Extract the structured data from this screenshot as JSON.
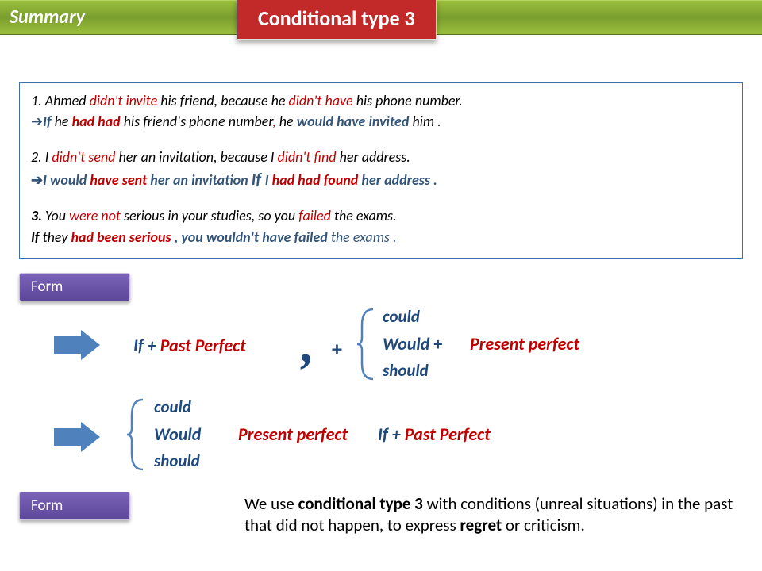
{
  "header": {
    "summary": "Summary",
    "title": "Conditional type 3"
  },
  "examples": {
    "e1a_pre": "1. Ahmed ",
    "e1a_red1": "didn't invite ",
    "e1a_mid": "his friend, because he ",
    "e1a_red2": "didn't have ",
    "e1a_post": "his phone number.",
    "e1b_if": "If ",
    "e1b_1": "he ",
    "e1b_red1": "had had ",
    "e1b_2": "his friend's phone number",
    "e1b_commaRed": ", ",
    "e1b_3": "he ",
    "e1b_steel": "would have invited ",
    "e1b_4": "him .",
    "e2a_pre": "2. I ",
    "e2a_red1": "didn't send ",
    "e2a_mid": "her an invitation, because I ",
    "e2a_red2": "didn't find ",
    "e2a_post": "her address.",
    "e2b_1": "I would ",
    "e2b_red1": "have sent ",
    "e2b_2": "her an invitation ",
    "e2b_if": "If ",
    "e2b_3": "I ",
    "e2b_red2": "had had found ",
    "e2b_4": "her address .",
    "e3a_pre": "3. ",
    "e3a_1": "You ",
    "e3a_red1": "were not ",
    "e3a_2": "serious in your studies, so you ",
    "e3a_red2": "failed ",
    "e3a_3": "the exams.",
    "e3b_if": "If  ",
    "e3b_1": "they ",
    "e3b_red1": "had  been serious ",
    "e3b_2": ", you ",
    "e3b_u": "wouldn't",
    "e3b_3": " have failed ",
    "e3b_4": "the exams ."
  },
  "form": {
    "label": "Form",
    "ifPlus": "If + ",
    "pastPerfect": "Past Perfect",
    "comma": ",",
    "plus": "+",
    "could": "could",
    "would": "Would",
    "wouldPlus": "Would +",
    "should": "should",
    "presentPerfect": "Present perfect"
  },
  "usage": {
    "t1": "We use ",
    "bold1": "conditional type 3 ",
    "t2": "with conditions (unreal situations)  in the past that did not happen, to express ",
    "bold2": "regret ",
    "t3": "or criticism."
  }
}
